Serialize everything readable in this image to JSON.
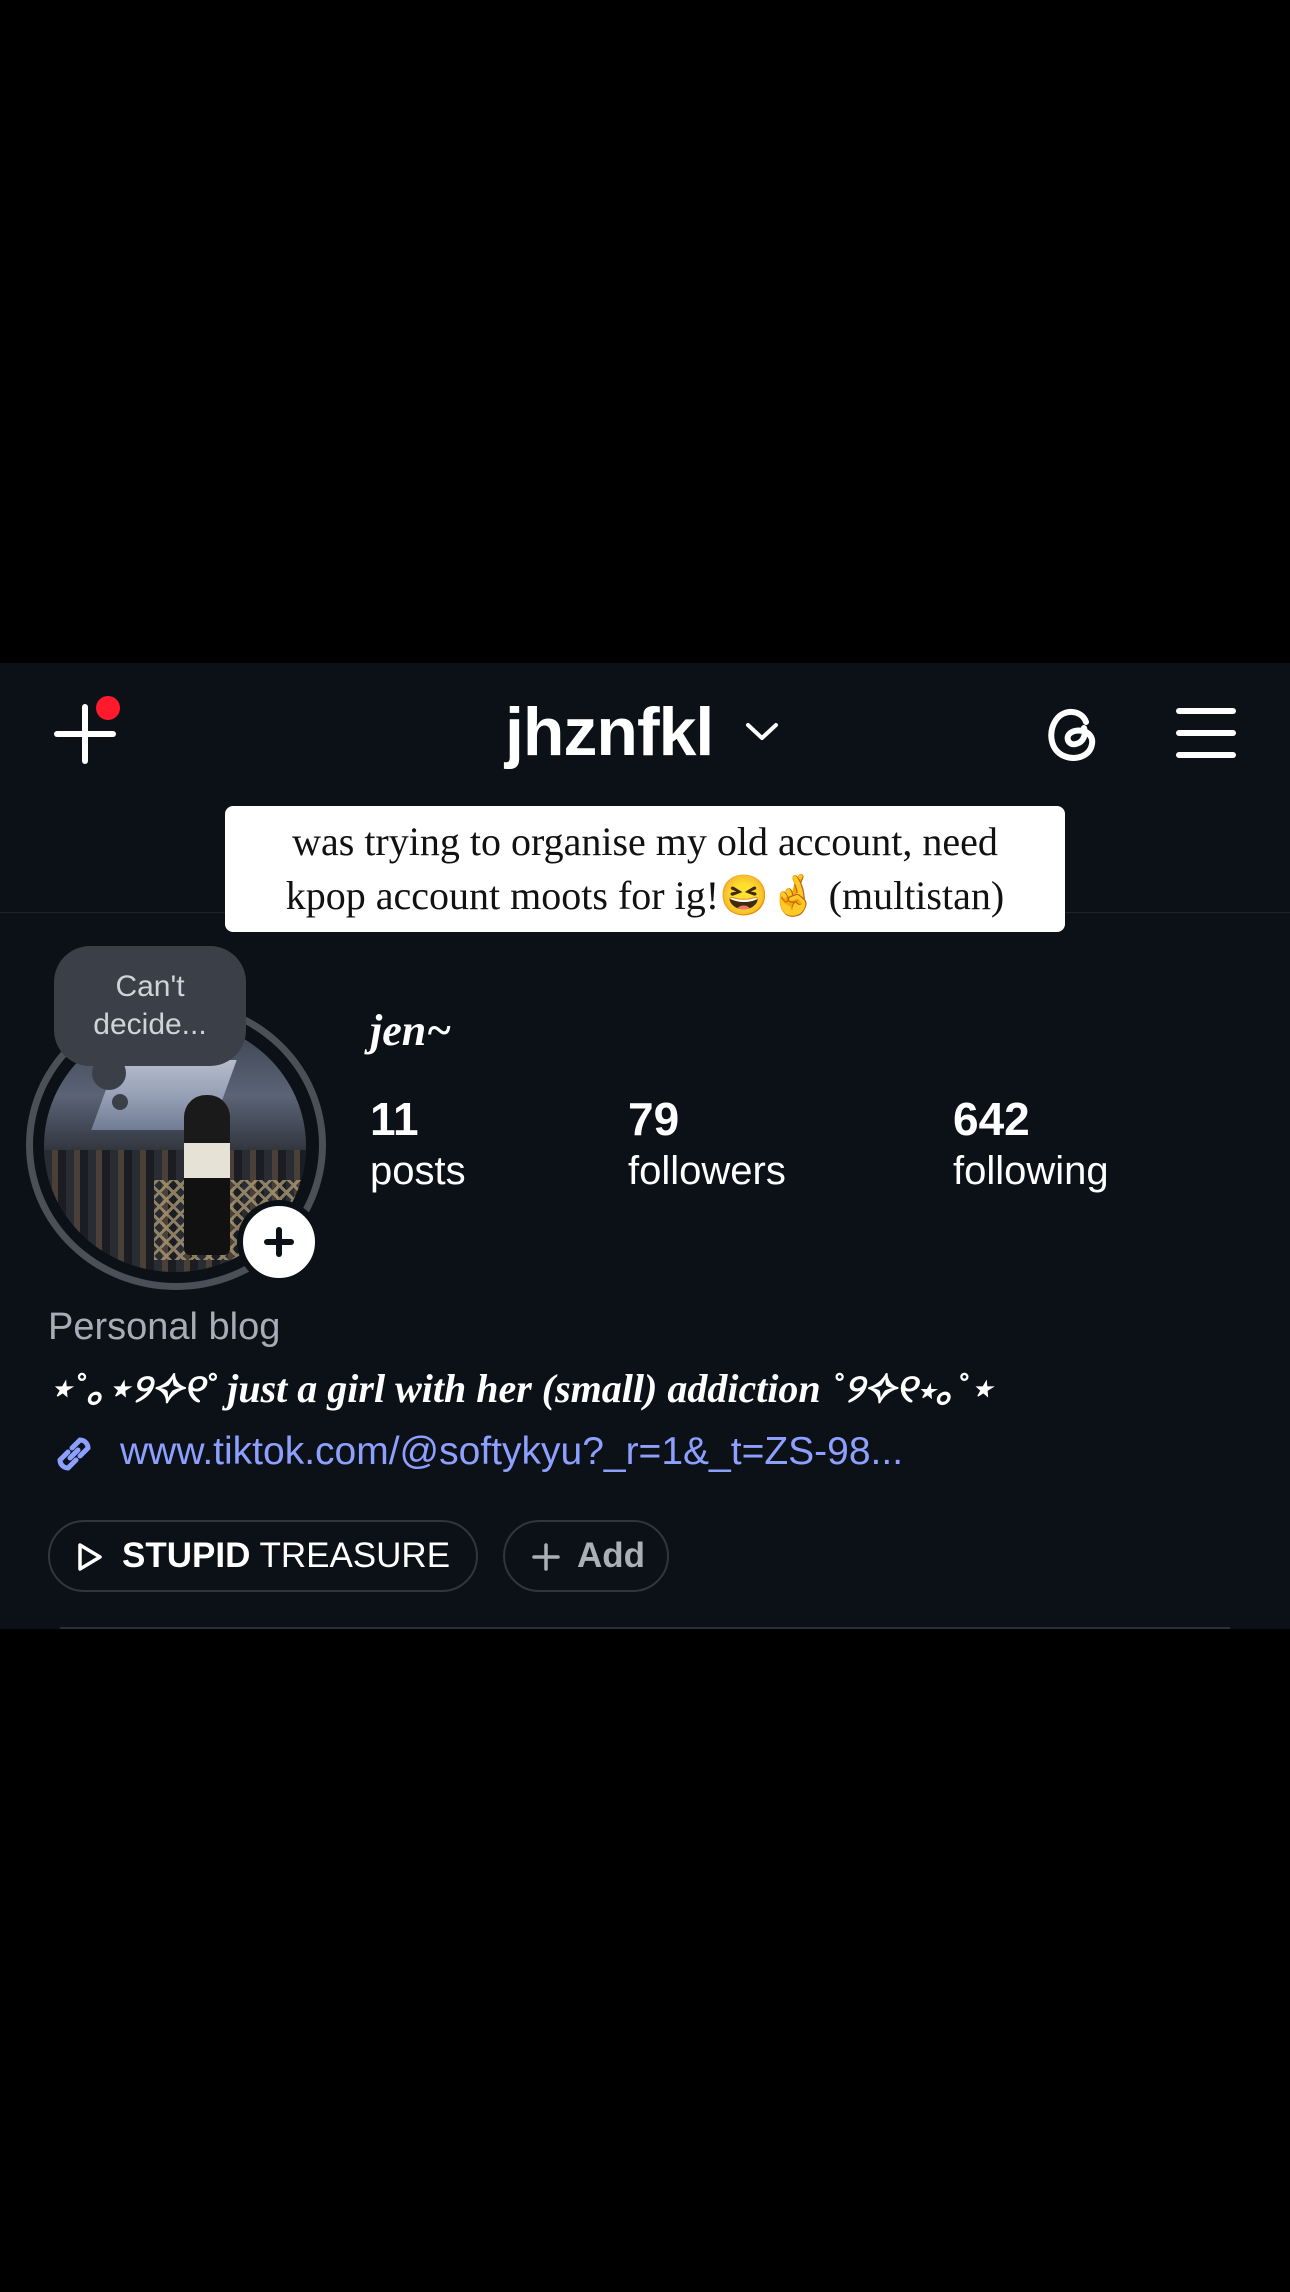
{
  "header": {
    "username": "jhznfkl",
    "new_post_icon": "plus-icon",
    "threads_icon": "threads-icon",
    "menu_icon": "hamburger-menu-icon",
    "notification_color": "#ff1a2e"
  },
  "sticker": {
    "line1": "was trying to organise my old account, need",
    "line2": "kpop account moots for ig!😆🤞 (multistan)"
  },
  "profile": {
    "note_line1": "Can't",
    "note_line2": "decide...",
    "display_name": "jen~",
    "stats": [
      {
        "value": "11",
        "label": "posts"
      },
      {
        "value": "79",
        "label": "followers"
      },
      {
        "value": "642",
        "label": "following"
      }
    ],
    "category": "Personal blog",
    "bio": "⋆˚｡⋆୨✧୧˚ just a girl with her (small) addiction ˚୨✧୧⋆｡˚⋆",
    "link": "www.tiktok.com/@softykyu?_r=1&_t=ZS-98...",
    "link_color": "#8ea0ff"
  },
  "actions": {
    "music_bold": "STUPID",
    "music_rest": "TREASURE",
    "add_label": "Add"
  }
}
